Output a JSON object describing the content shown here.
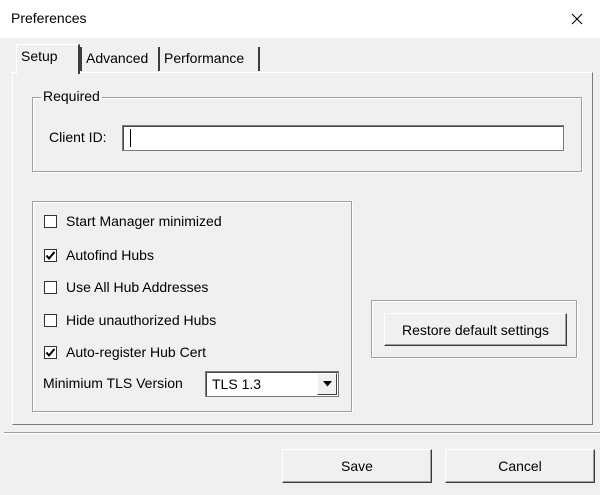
{
  "window": {
    "title": "Preferences"
  },
  "tabs": [
    {
      "label": "Setup",
      "active": true
    },
    {
      "label": "Advanced",
      "active": false
    },
    {
      "label": "Performance",
      "active": false
    }
  ],
  "required_group": {
    "legend": "Required",
    "client_id_label": "Client ID:",
    "client_id_value": ""
  },
  "options": [
    {
      "label": "Start Manager minimized",
      "checked": false
    },
    {
      "label": "Autofind Hubs",
      "checked": true
    },
    {
      "label": "Use All Hub Addresses",
      "checked": false
    },
    {
      "label": "Hide unauthorized Hubs",
      "checked": false
    },
    {
      "label": "Auto-register Hub Cert",
      "checked": true
    }
  ],
  "tls": {
    "label": "Minimium TLS Version",
    "selected": "TLS 1.3"
  },
  "buttons": {
    "restore": "Restore default settings",
    "save": "Save",
    "cancel": "Cancel"
  },
  "icons": {
    "close": "close-icon",
    "check": "checkmark-icon",
    "dropdown": "chevron-down-icon"
  }
}
